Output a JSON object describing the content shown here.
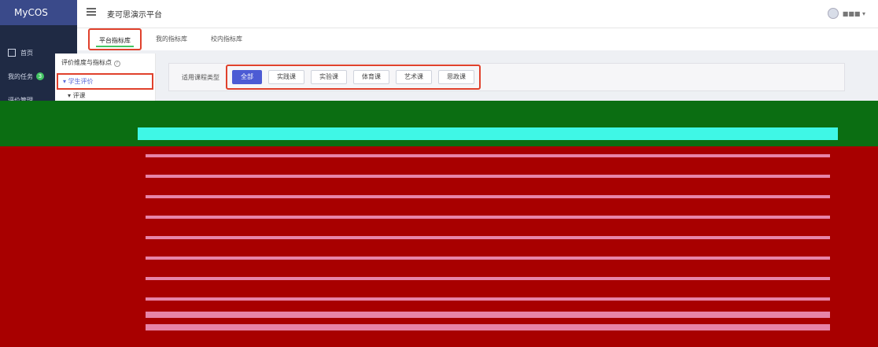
{
  "app": {
    "brand": "MyCOS",
    "title": "麦可思演示平台"
  },
  "sidebar": {
    "items": [
      {
        "label": "首页"
      },
      {
        "label": "我的任务",
        "badge": "3"
      },
      {
        "label": "评价管理"
      }
    ]
  },
  "user": {
    "name": "■■■ ▾"
  },
  "tabs": [
    {
      "label": "平台指标库",
      "active": true
    },
    {
      "label": "我的指标库",
      "active": false
    },
    {
      "label": "校内指标库",
      "active": false
    }
  ],
  "tree": {
    "title": "评价维度与指标点",
    "help": "?",
    "node": "学生评价",
    "sub": "评课"
  },
  "filter": {
    "label": "适用课程类型",
    "chips": [
      {
        "label": "全部",
        "active": true
      },
      {
        "label": "实践课",
        "active": false
      },
      {
        "label": "实验课",
        "active": false
      },
      {
        "label": "体育课",
        "active": false
      },
      {
        "label": "艺术课",
        "active": false
      },
      {
        "label": "思政课",
        "active": false
      }
    ]
  },
  "colors": {
    "accent": "#4c5bd4",
    "highlight": "#e0412c",
    "sidebar": "#1f2a44"
  }
}
